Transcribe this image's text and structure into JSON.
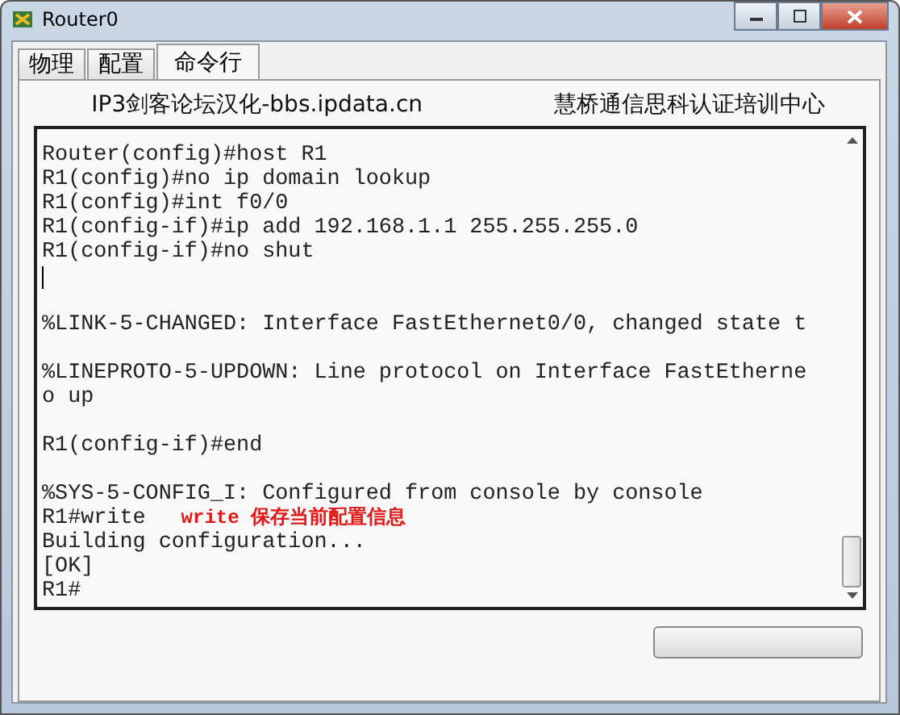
{
  "window": {
    "title": "Router0"
  },
  "tabs": [
    {
      "label": "物理",
      "selected": false
    },
    {
      "label": "配置",
      "selected": false
    },
    {
      "label": "命令行",
      "selected": true
    }
  ],
  "header": {
    "left": "IP3剑客论坛汉化-bbs.ipdata.cn",
    "right": "慧桥通信思科认证培训中心"
  },
  "terminal": {
    "lines": [
      {
        "kind": "text",
        "text": "Router(config)#host R1"
      },
      {
        "kind": "text",
        "text": "R1(config)#no ip domain lookup"
      },
      {
        "kind": "text",
        "text": "R1(config)#int f0/0"
      },
      {
        "kind": "text",
        "text": "R1(config-if)#ip add 192.168.1.1 255.255.255.0"
      },
      {
        "kind": "text",
        "text": "R1(config-if)#no shut"
      },
      {
        "kind": "cursor"
      },
      {
        "kind": "blank"
      },
      {
        "kind": "text",
        "text": "%LINK-5-CHANGED: Interface FastEthernet0/0, changed state t"
      },
      {
        "kind": "blank"
      },
      {
        "kind": "text",
        "text": "%LINEPROTO-5-UPDOWN: Line protocol on Interface FastEtherne"
      },
      {
        "kind": "text",
        "text": "o up"
      },
      {
        "kind": "blank"
      },
      {
        "kind": "text",
        "text": "R1(config-if)#end"
      },
      {
        "kind": "blank"
      },
      {
        "kind": "text",
        "text": "%SYS-5-CONFIG_I: Configured from console by console"
      },
      {
        "kind": "text",
        "text": "R1#write",
        "note": "write 保存当前配置信息"
      },
      {
        "kind": "text",
        "text": "Building configuration..."
      },
      {
        "kind": "text",
        "text": "[OK]"
      },
      {
        "kind": "text",
        "text": "R1#"
      }
    ]
  }
}
